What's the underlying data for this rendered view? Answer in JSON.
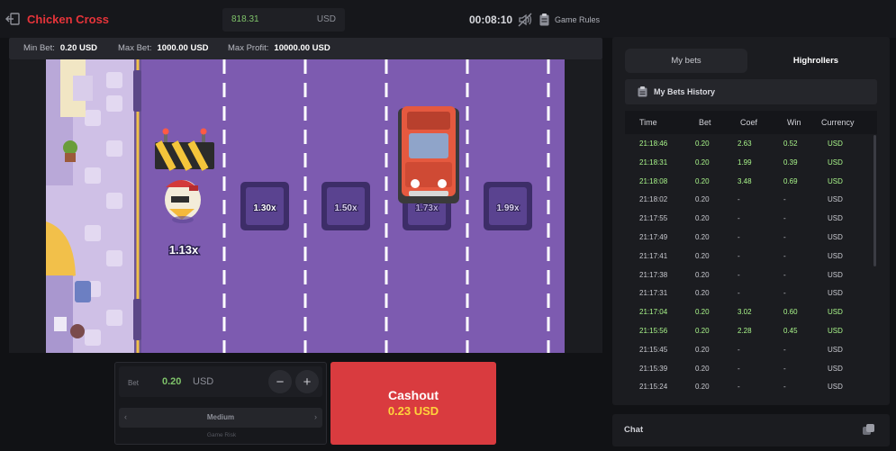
{
  "header": {
    "title": "Chicken Cross",
    "balance": "818.31",
    "balance_currency": "USD",
    "timer": "00:08:10",
    "rules_label": "Game Rules"
  },
  "limits": {
    "min_bet_label": "Min Bet:",
    "min_bet_value": "0.20 USD",
    "max_bet_label": "Max Bet:",
    "max_bet_value": "1000.00 USD",
    "max_profit_label": "Max Profit:",
    "max_profit_value": "10000.00 USD"
  },
  "game": {
    "chicken_multiplier": "1.13x",
    "lane_multipliers": [
      "1.30x",
      "1.50x",
      "1.73x",
      "1.99x"
    ]
  },
  "controls": {
    "bet_label": "Bet",
    "bet_value": "0.20",
    "bet_currency": "USD",
    "minus": "−",
    "plus": "+",
    "risk_value": "Medium",
    "risk_label": "Game Risk",
    "risk_left": "‹",
    "risk_right": "›",
    "cashout_label": "Cashout",
    "cashout_amount": "0.23 USD"
  },
  "bets_panel": {
    "tabs": [
      {
        "label": "My bets"
      },
      {
        "label": "Highrollers"
      }
    ],
    "history_title": "My Bets History",
    "columns": [
      "Time",
      "Bet",
      "Coef",
      "Win",
      "Currency"
    ],
    "rows": [
      {
        "time": "21:18:46",
        "bet": "0.20",
        "coef": "2.63",
        "win": "0.52",
        "currency": "USD",
        "won": true
      },
      {
        "time": "21:18:31",
        "bet": "0.20",
        "coef": "1.99",
        "win": "0.39",
        "currency": "USD",
        "won": true
      },
      {
        "time": "21:18:08",
        "bet": "0.20",
        "coef": "3.48",
        "win": "0.69",
        "currency": "USD",
        "won": true
      },
      {
        "time": "21:18:02",
        "bet": "0.20",
        "coef": "-",
        "win": "-",
        "currency": "USD",
        "won": false
      },
      {
        "time": "21:17:55",
        "bet": "0.20",
        "coef": "-",
        "win": "-",
        "currency": "USD",
        "won": false
      },
      {
        "time": "21:17:49",
        "bet": "0.20",
        "coef": "-",
        "win": "-",
        "currency": "USD",
        "won": false
      },
      {
        "time": "21:17:41",
        "bet": "0.20",
        "coef": "-",
        "win": "-",
        "currency": "USD",
        "won": false
      },
      {
        "time": "21:17:38",
        "bet": "0.20",
        "coef": "-",
        "win": "-",
        "currency": "USD",
        "won": false
      },
      {
        "time": "21:17:31",
        "bet": "0.20",
        "coef": "-",
        "win": "-",
        "currency": "USD",
        "won": false
      },
      {
        "time": "21:17:04",
        "bet": "0.20",
        "coef": "3.02",
        "win": "0.60",
        "currency": "USD",
        "won": true
      },
      {
        "time": "21:15:56",
        "bet": "0.20",
        "coef": "2.28",
        "win": "0.45",
        "currency": "USD",
        "won": true
      },
      {
        "time": "21:15:45",
        "bet": "0.20",
        "coef": "-",
        "win": "-",
        "currency": "USD",
        "won": false
      },
      {
        "time": "21:15:39",
        "bet": "0.20",
        "coef": "-",
        "win": "-",
        "currency": "USD",
        "won": false
      },
      {
        "time": "21:15:24",
        "bet": "0.20",
        "coef": "-",
        "win": "-",
        "currency": "USD",
        "won": false
      }
    ]
  },
  "chat": {
    "label": "Chat"
  },
  "colors": {
    "accent_red": "#e6343a",
    "win_green": "#a9f58a",
    "road": "#7d5bb0",
    "cashout": "#d93b3f"
  }
}
